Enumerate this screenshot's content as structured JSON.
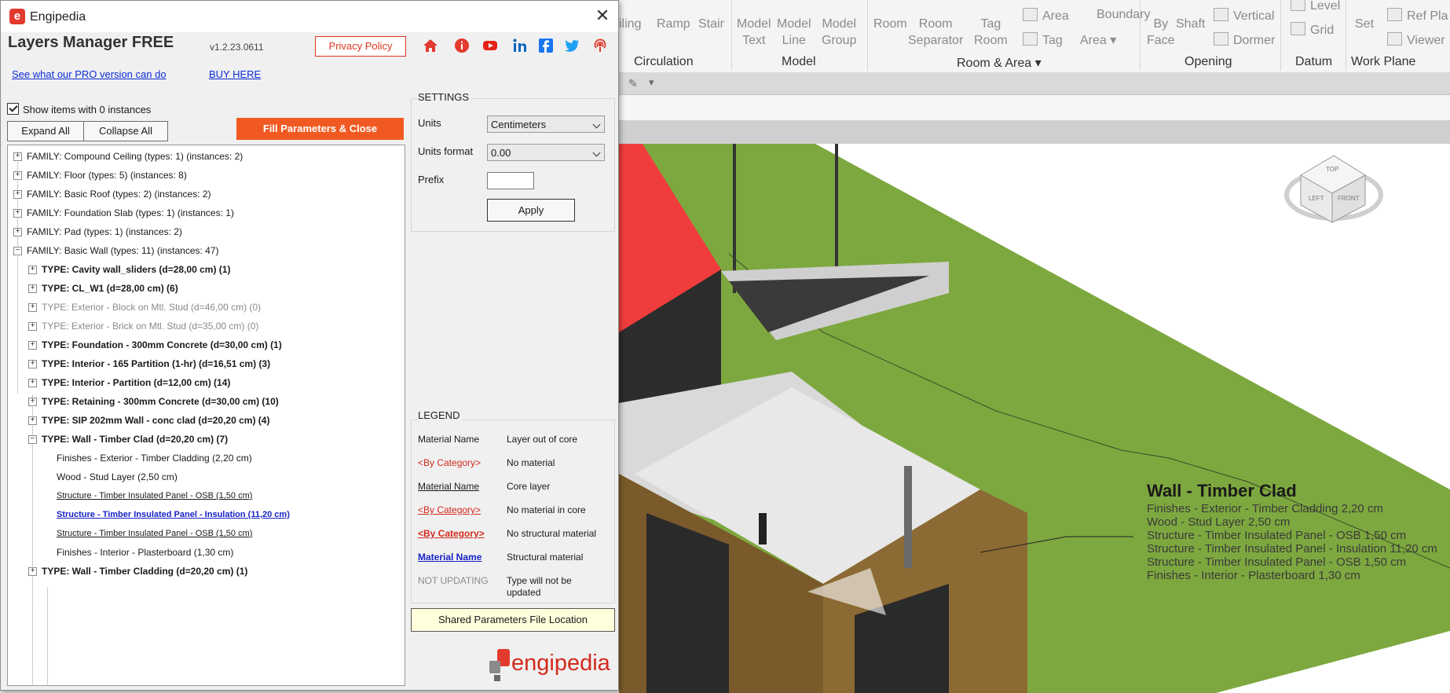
{
  "ribbon": {
    "buttons": [
      {
        "label": "iling"
      },
      {
        "label": "Ramp"
      },
      {
        "label": "Stair"
      },
      {
        "label": "Model\nText"
      },
      {
        "label": "Model\nLine"
      },
      {
        "label": "Model\nGroup"
      },
      {
        "label": "Room"
      },
      {
        "label": "Room\nSeparator"
      },
      {
        "label": "Tag\nRoom"
      },
      {
        "label": "By\nFace"
      },
      {
        "label": "Shaft"
      },
      {
        "label": "Set"
      }
    ],
    "small_items": [
      "Area",
      "Boundary",
      "Tag",
      "Area",
      "Vertical",
      "Dormer",
      "Grid",
      "Level",
      "Ref",
      "Pla",
      "Viewer"
    ],
    "panels": [
      "Circulation",
      "Model",
      "Room & Area",
      "Opening",
      "Datum",
      "Work Plane"
    ]
  },
  "window": {
    "title": "Engipedia",
    "product_name": "Layers Manager FREE",
    "version": "v1.2.23.0611",
    "privacy_label": "Privacy Policy",
    "pro_link": "See what our PRO version can do",
    "buy_link": "BUY HERE",
    "show_zero_label": "Show items with 0 instances",
    "expand_all": "Expand All",
    "collapse_all": "Collapse All",
    "fill_button": "Fill Parameters & Close",
    "brand": "engipedia",
    "social_icons": [
      "home-icon",
      "info-icon",
      "youtube-icon",
      "linkedin-icon",
      "facebook-icon",
      "twitter-icon",
      "podcast-icon"
    ]
  },
  "tree": {
    "families": [
      "FAMILY: Compound Ceiling (types: 1) (instances: 2)",
      "FAMILY: Floor (types: 5) (instances: 8)",
      "FAMILY: Basic Roof (types: 2) (instances: 2)",
      "FAMILY: Foundation Slab (types: 1) (instances: 1)",
      "FAMILY: Pad (types: 1) (instances: 2)",
      "FAMILY: Basic Wall (types: 11) (instances: 47)"
    ],
    "types": [
      "TYPE: Cavity wall_sliders (d=28,00 cm) (1)",
      "TYPE: CL_W1 (d=28,00 cm) (6)",
      "TYPE: Exterior - Block on Mtl. Stud (d=46,00 cm) (0)",
      "TYPE: Exterior - Brick on Mtl. Stud (d=35,00 cm) (0)",
      "TYPE: Foundation - 300mm Concrete (d=30,00 cm) (1)",
      "TYPE: Interior - 165 Partition (1-hr) (d=16,51 cm) (3)",
      "TYPE: Interior - Partition (d=12,00 cm) (14)",
      "TYPE: Retaining - 300mm Concrete (d=30,00 cm) (10)",
      "TYPE: SIP 202mm Wall - conc clad (d=20,20 cm) (4)",
      "TYPE: Wall - Timber Clad (d=20,20 cm) (7)"
    ],
    "layers": [
      "Finishes - Exterior - Timber Cladding (2,20 cm)",
      "Wood - Stud Layer (2,50 cm)",
      "Structure - Timber Insulated Panel - OSB (1,50 cm)",
      "Structure - Timber Insulated Panel - Insulation (11,20 cm)",
      "Structure - Timber Insulated Panel - OSB (1,50 cm)",
      "Finishes - Interior - Plasterboard (1,30 cm)"
    ],
    "last_type": "TYPE: Wall - Timber Cladding (d=20,20 cm) (1)"
  },
  "settings": {
    "title": "SETTINGS",
    "units_label": "Units",
    "units_value": "Centimeters",
    "format_label": "Units format",
    "format_value": "0.00",
    "prefix_label": "Prefix",
    "apply": "Apply"
  },
  "legend": {
    "title": "LEGEND",
    "rows": [
      {
        "left": "Material Name",
        "right": "Layer out of core"
      },
      {
        "left": "<By Category>",
        "right": "No material"
      },
      {
        "left": "Material Name",
        "right": "Core layer"
      },
      {
        "left": "<By Category>",
        "right": "No material in core"
      },
      {
        "left": "<By Category>",
        "right": "No structural material"
      },
      {
        "left": "Material Name",
        "right": "Structural material"
      },
      {
        "left": "NOT UPDATING",
        "right": "Type will not be updated"
      }
    ],
    "shared_button": "Shared Parameters File Location"
  },
  "tag": {
    "title": "Wall - Timber Clad",
    "lines": [
      "Finishes - Exterior - Timber Cladding 2,20 cm",
      "Wood - Stud Layer 2,50 cm",
      "Structure - Timber Insulated Panel - OSB 1,50 cm",
      "Structure - Timber Insulated Panel - Insulation 11,20 cm",
      "Structure - Timber Insulated Panel - OSB 1,50 cm",
      "Finishes - Interior - Plasterboard 1,30 cm"
    ]
  },
  "viewcube": {
    "top": "TOP",
    "left": "LEFT",
    "front": "FRONT"
  },
  "colors": {
    "accent": "#f05a22",
    "brand_red": "#d22a1d",
    "link_blue": "#0a2bd6",
    "grass": "#7da83f",
    "roof": "#f03c3c"
  }
}
